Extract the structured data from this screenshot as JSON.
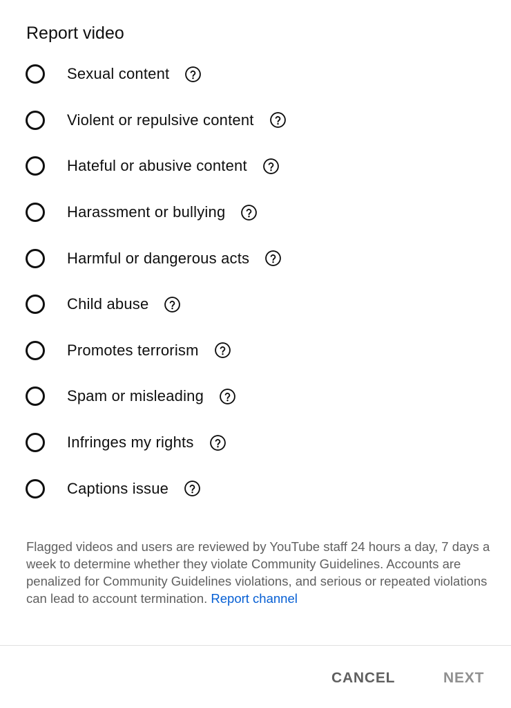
{
  "dialog": {
    "title": "Report video",
    "options": [
      {
        "label": "Sexual content",
        "icon": "help-icon"
      },
      {
        "label": "Violent or repulsive content",
        "icon": "help-icon"
      },
      {
        "label": "Hateful or abusive content",
        "icon": "help-icon"
      },
      {
        "label": "Harassment or bullying",
        "icon": "help-icon"
      },
      {
        "label": "Harmful or dangerous acts",
        "icon": "help-icon"
      },
      {
        "label": "Child abuse",
        "icon": "help-icon"
      },
      {
        "label": "Promotes terrorism",
        "icon": "help-icon"
      },
      {
        "label": "Spam or misleading",
        "icon": "help-icon"
      },
      {
        "label": "Infringes my rights",
        "icon": "help-icon"
      },
      {
        "label": "Captions issue",
        "icon": "help-icon"
      }
    ],
    "notice_text": "Flagged videos and users are reviewed by YouTube staff 24 hours a day, 7 days a week to determine whether they violate Community Guidelines. Accounts are penalized for Community Guidelines violations, and serious or repeated violations can lead to account termination.",
    "report_channel_link": "Report channel",
    "cancel_label": "CANCEL",
    "next_label": "NEXT"
  },
  "colors": {
    "text": "#0f0f0f",
    "secondary_text": "#606060",
    "link": "#065fd4",
    "disabled": "#909090",
    "divider": "#e0e0e0"
  }
}
